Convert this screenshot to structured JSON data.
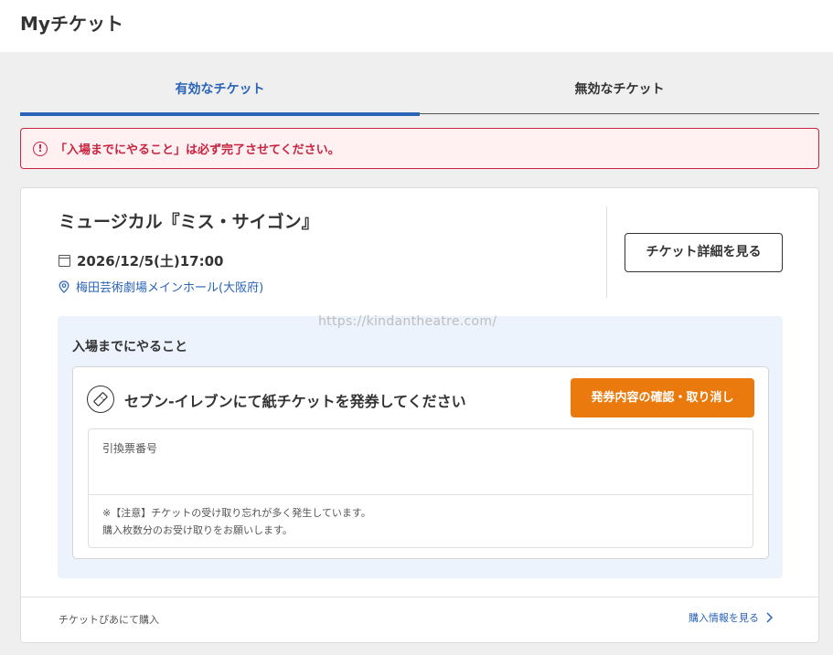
{
  "header": {
    "title": "Myチケット"
  },
  "tabs": [
    {
      "label": "有効なチケット",
      "active": true
    },
    {
      "label": "無効なチケット",
      "active": false
    }
  ],
  "alert": {
    "icon": "exclamation-circle-icon",
    "text": "「入場までにやること」は必ず完了させてください。"
  },
  "event": {
    "title": "ミュージカル『ミス・サイゴン』",
    "date": "2026/12/5(土)17:00",
    "venue": "梅田芸術劇場メインホール(大阪府)",
    "detail_button": "チケット詳細を見る"
  },
  "watermark": "https://kindantheatre.com/",
  "todo": {
    "heading": "入場までにやること",
    "task": {
      "icon": "ticket-icon",
      "label": "セブン-イレブンにて紙チケットを発券してください",
      "button": "発券内容の確認・取り消し",
      "field_label": "引換票番号",
      "note_line1": "※【注意】チケットの受け取り忘れが多く発生しています。",
      "note_line2": "購入枚数分のお受け取りをお願いします。"
    }
  },
  "footer": {
    "left": "チケットぴあにて購入",
    "right": "購入情報を見る"
  },
  "colors": {
    "accent": "#2a63b8",
    "alert": "#c8243f",
    "orange": "#ea7a0e"
  }
}
